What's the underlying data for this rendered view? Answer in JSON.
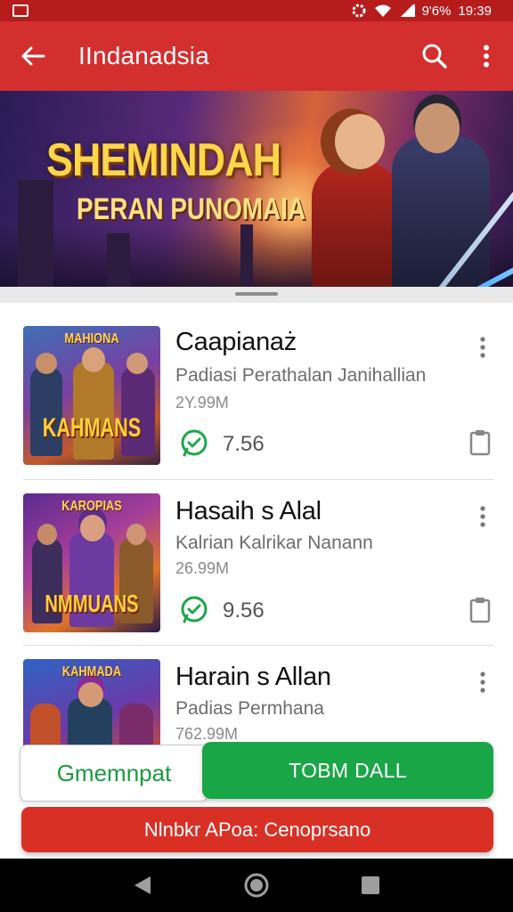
{
  "status_bar": {
    "battery": "9'6%",
    "time": "19:39"
  },
  "app_bar": {
    "title": "IIndanadsia",
    "icons": {
      "back": "arrow-left-icon",
      "search": "search-icon",
      "menu": "more-vert-icon"
    }
  },
  "banner": {
    "headline": "SHEMINDAH",
    "subhead": "PERAN PUNOMAIA"
  },
  "apps": [
    {
      "name": "Caapianaż",
      "description": "Padiasi Perathalan Janihallian",
      "size": "2Y.99M",
      "rating": "7.56",
      "thumb_top": "MAHIONA",
      "thumb_title": "KAHMANS"
    },
    {
      "name": "Hasaih s Alal",
      "description": "Kalrian Kalrikar Nanann",
      "size": "26.99M",
      "rating": "9.56",
      "thumb_top": "KAROPIAS",
      "thumb_title": "NMMUANS"
    },
    {
      "name": "Harain s Allan",
      "description": "Padias Permhana",
      "size": "762.99M",
      "rating": "",
      "thumb_top": "KAHMADA",
      "thumb_title": ""
    }
  ],
  "buttons": {
    "secondary": "Gmemnpat",
    "primary": "TOBM DALL",
    "banner_action": "Nlnbkr APoa: Cenoprsano"
  },
  "colors": {
    "app_bar": "#d32f2f",
    "primary_green": "#19a647",
    "action_red": "#d93025"
  }
}
